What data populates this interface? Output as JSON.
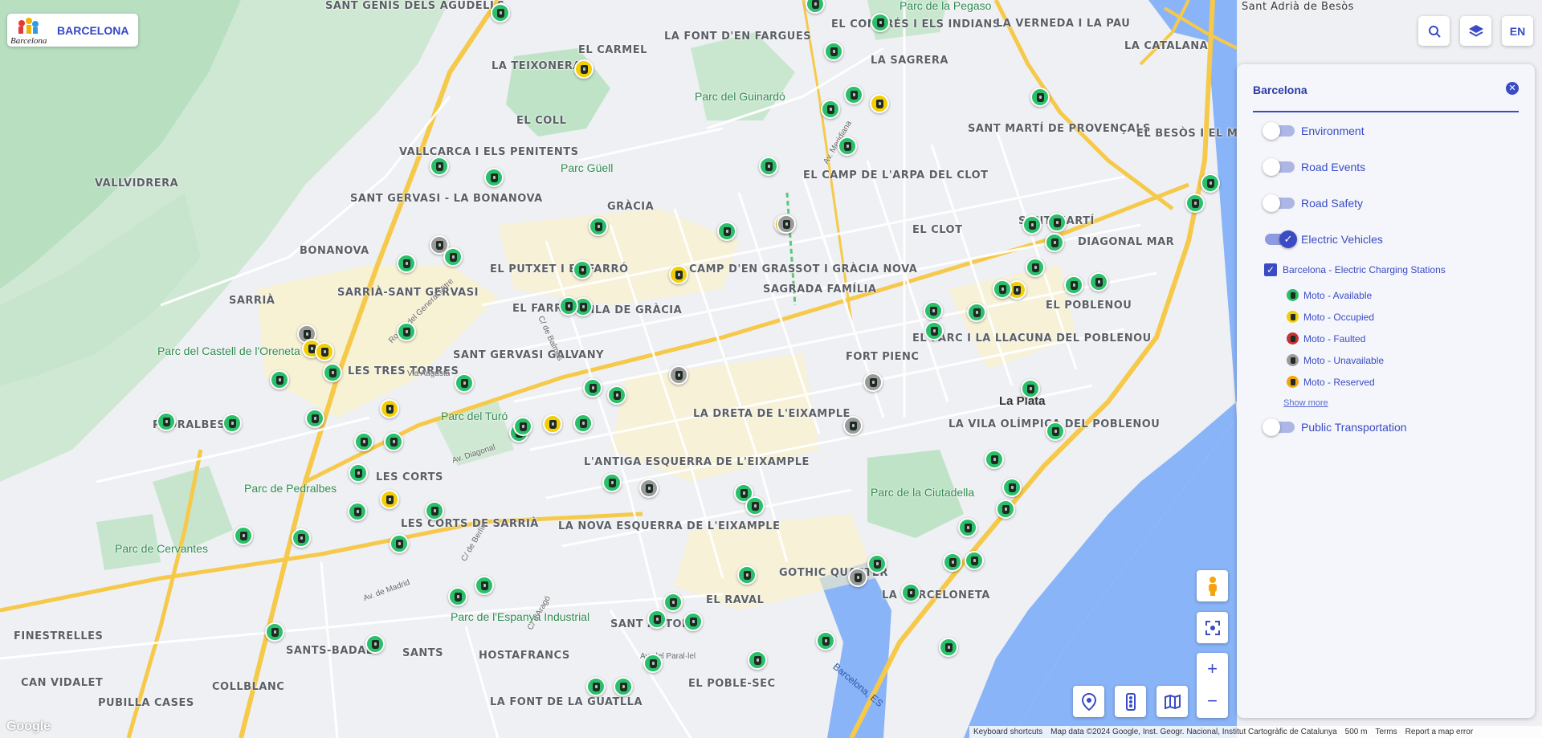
{
  "brand": {
    "name": "BARCELONA",
    "logo_text": "Barcelona"
  },
  "top_controls": {
    "search_icon": "search-icon",
    "layers_icon": "layers-icon",
    "language": "EN"
  },
  "panel": {
    "title": "Barcelona",
    "toggles": [
      {
        "label": "Environment",
        "on": false
      },
      {
        "label": "Road Events",
        "on": false
      },
      {
        "label": "Road Safety",
        "on": false
      },
      {
        "label": "Electric Vehicles",
        "on": true
      }
    ],
    "layer": {
      "label": "Barcelona - Electric Charging Stations",
      "checked": true
    },
    "legend": [
      {
        "label": "Moto - Available",
        "color": "#2bbf6b"
      },
      {
        "label": "Moto - Occupied",
        "color": "#f3cd07"
      },
      {
        "label": "Moto - Faulted",
        "color": "#c4323a"
      },
      {
        "label": "Moto - Unavailable",
        "color": "#9a9a9a"
      },
      {
        "label": "Moto - Reserved",
        "color": "#f4a40f"
      }
    ],
    "show_more": "Show more",
    "last_toggle": {
      "label": "Public Transportation",
      "on": false
    }
  },
  "map": {
    "places": [
      "SANT GENÍS DELS AGUDELLS",
      "EL CARMEL",
      "LA TEIXONERA",
      "LA FONT D'EN FARGUES",
      "EL CONGRÉS I ELS INDIANS",
      "LA SAGRERA",
      "LA VERNEDA I LA PAU",
      "LA CATALANA",
      "EL COLL",
      "VALLCARCA I ELS PENITENTS",
      "SANT MARTÍ DE PROVENÇALS",
      "EL BESÒS I EL MARESME",
      "VALLVIDRERA",
      "SANT GERVASI - LA BONANOVA",
      "GRÀCIA",
      "EL CAMP DE L'ARPA DEL CLOT",
      "EL CLOT",
      "SANT MARTÍ",
      "DIAGONAL MAR",
      "BONANOVA",
      "EL PUTXET I EL FARRÓ",
      "CAMP D'EN GRASSOT I GRÀCIA NOVA",
      "SAGRADA FAMÍLIA",
      "SARRIÀ",
      "SARRIÀ-SANT GERVASI",
      "EL FARRÓ",
      "VILA DE GRÀCIA",
      "EL POBLENOU",
      "LES TRES TORRES",
      "SANT GERVASI GALVANY",
      "FORT PIENC",
      "EL PARC I LA LLACUNA DEL POBLENOU",
      "PEDRALBES",
      "LA DRETA DE L'EIXAMPLE",
      "LA VILA OLÍMPICA DEL POBLENOU",
      "LES CORTS",
      "L'ANTIGA ESQUERRA DE L'EIXAMPLE",
      "LES CORTS DE SARRIÀ",
      "LA NOVA ESQUERRA DE L'EIXAMPLE",
      "GOTHIC QUARTER",
      "LA BARCELONETA",
      "EL RAVAL",
      "SANT ANTONI",
      "FINESTRELLES",
      "SANTS-BADAL",
      "SANTS",
      "HOSTAFRANCS",
      "CAN VIDALET",
      "COLLBLANC",
      "PUBILLA CASES",
      "LA FONT DE LA GUATLLA",
      "EL POBLE-SEC",
      "Sant Adrià de Besòs",
      "La Plata"
    ],
    "parks": [
      "Parc de la Pegaso",
      "Parc del Guinardó",
      "Parc Güell",
      "Parc del Castell de l'Oreneta",
      "Parc del Turó",
      "Parc de Pedralbes",
      "Parc de Cervantes",
      "Parc de la Ciutadella",
      "Parc de l'Espanya Industrial"
    ],
    "streets": [
      "Via Augusta",
      "Av. Diagonal",
      "C/ de Balmes",
      "Ronda del General Mitre",
      "Av. de Madrid",
      "C/ de Berlín",
      "C/ d'Aragó",
      "Av. Meridiana",
      "Av. del Paral·lel"
    ],
    "water": "Barcelona, ES"
  },
  "markers": [
    {
      "s": "available"
    },
    {
      "s": "available"
    },
    {
      "s": "available"
    },
    {
      "s": "occupied"
    },
    {
      "s": "available"
    },
    {
      "s": "occupied"
    },
    {
      "s": "available"
    },
    {
      "s": "available"
    },
    {
      "s": "available"
    },
    {
      "s": "available"
    },
    {
      "s": "available"
    },
    {
      "s": "available"
    },
    {
      "s": "available"
    },
    {
      "s": "available"
    },
    {
      "s": "available"
    },
    {
      "s": "available"
    },
    {
      "s": "unavailable"
    },
    {
      "s": "occupied"
    },
    {
      "s": "available"
    },
    {
      "s": "available"
    },
    {
      "s": "unavailable"
    },
    {
      "s": "available"
    },
    {
      "s": "occupied"
    },
    {
      "s": "available"
    },
    {
      "s": "available"
    },
    {
      "s": "available"
    },
    {
      "s": "available"
    },
    {
      "s": "available"
    },
    {
      "s": "occupied"
    },
    {
      "s": "unavailable"
    },
    {
      "s": "occupied"
    },
    {
      "s": "occupied"
    },
    {
      "s": "available"
    },
    {
      "s": "available"
    },
    {
      "s": "available"
    },
    {
      "s": "occupied"
    },
    {
      "s": "available"
    },
    {
      "s": "available"
    },
    {
      "s": "available"
    },
    {
      "s": "available"
    },
    {
      "s": "available"
    },
    {
      "s": "available"
    },
    {
      "s": "available"
    },
    {
      "s": "occupied"
    },
    {
      "s": "available"
    },
    {
      "s": "available"
    },
    {
      "s": "available"
    },
    {
      "s": "available"
    },
    {
      "s": "available"
    },
    {
      "s": "available"
    },
    {
      "s": "available"
    },
    {
      "s": "available"
    },
    {
      "s": "occupied"
    },
    {
      "s": "available"
    },
    {
      "s": "available"
    },
    {
      "s": "available"
    },
    {
      "s": "unavailable"
    },
    {
      "s": "available"
    },
    {
      "s": "available"
    },
    {
      "s": "available"
    },
    {
      "s": "available"
    },
    {
      "s": "available"
    },
    {
      "s": "available"
    },
    {
      "s": "available"
    },
    {
      "s": "available"
    },
    {
      "s": "available"
    },
    {
      "s": "available"
    },
    {
      "s": "available"
    },
    {
      "s": "available"
    },
    {
      "s": "available"
    },
    {
      "s": "available"
    },
    {
      "s": "available"
    },
    {
      "s": "unavailable"
    },
    {
      "s": "unavailable"
    },
    {
      "s": "available"
    },
    {
      "s": "unavailable"
    },
    {
      "s": "available"
    },
    {
      "s": "available"
    },
    {
      "s": "available"
    },
    {
      "s": "available"
    },
    {
      "s": "available"
    },
    {
      "s": "available"
    },
    {
      "s": "available"
    },
    {
      "s": "available"
    },
    {
      "s": "available"
    },
    {
      "s": "available"
    },
    {
      "s": "available"
    },
    {
      "s": "available"
    },
    {
      "s": "unavailable"
    },
    {
      "s": "available"
    },
    {
      "s": "available"
    },
    {
      "s": "available"
    },
    {
      "s": "available"
    },
    {
      "s": "available"
    },
    {
      "s": "available"
    }
  ],
  "map_controls": {
    "pegman_icon": "pegman-icon",
    "recenter_icon": "recenter-icon",
    "zoom_in": "+",
    "zoom_out": "−",
    "location_icon": "location-pin-icon",
    "traffic_icon": "traffic-light-icon",
    "map_type_icon": "map-icon"
  },
  "footer": {
    "shortcuts": "Keyboard shortcuts",
    "attribution": "Map data ©2024 Google, Inst. Geogr. Nacional, Institut Cartogràfic de Catalunya",
    "scale": "500 m",
    "terms": "Terms",
    "report": "Report a map error"
  },
  "google_logo": "Google"
}
